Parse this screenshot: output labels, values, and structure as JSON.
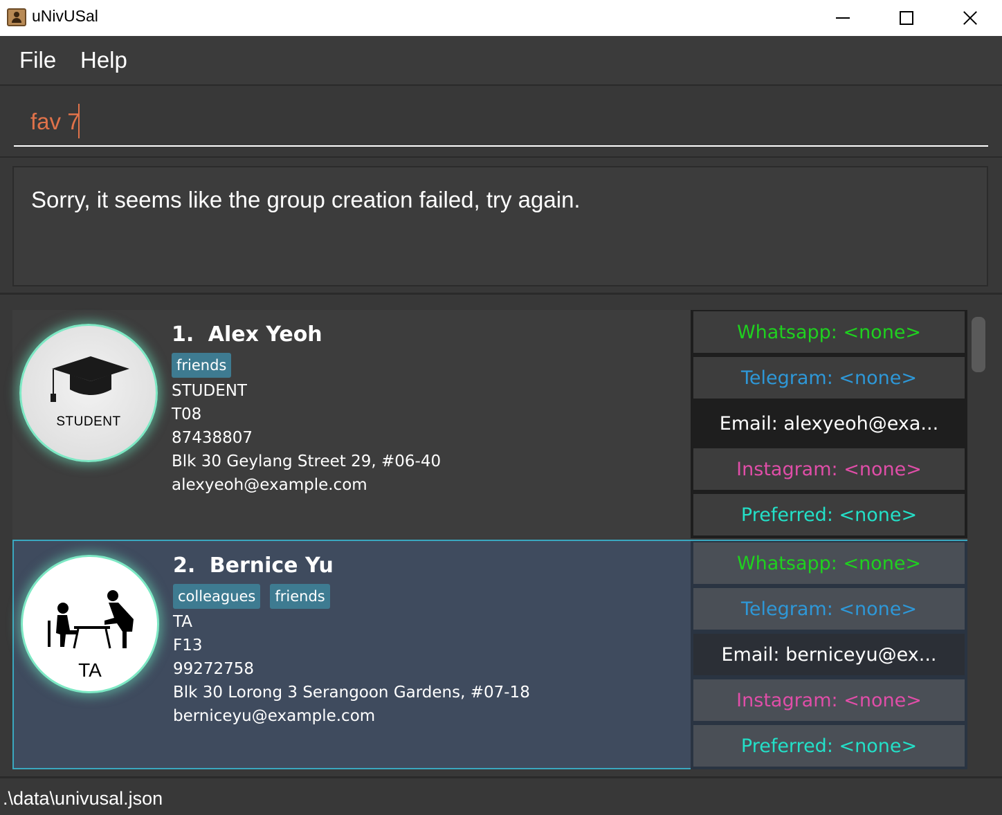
{
  "window": {
    "title": "uNivUSal",
    "app_icon": "contact-book-icon",
    "controls": [
      "minimize-icon",
      "maximize-icon",
      "close-icon"
    ]
  },
  "menu": {
    "file": "File",
    "help": "Help"
  },
  "command": {
    "value": "fav 7"
  },
  "result": {
    "message": "Sorry, it seems like the group creation failed, try again."
  },
  "persons": [
    {
      "index": "1.",
      "name": "Alex Yeoh",
      "avatar_label": "STUDENT",
      "avatar_icon": "graduation-cap-icon",
      "tags": [
        "friends"
      ],
      "role": "STUDENT",
      "tutorial": "T08",
      "phone": "87438807",
      "address": "Blk 30 Geylang Street 29, #06-40",
      "email": "alexyeoh@example.com",
      "contacts": {
        "whatsapp": "Whatsapp: <none>",
        "telegram": "Telegram: <none>",
        "email": "Email: alexyeoh@exa...",
        "instagram": "Instagram: <none>",
        "preferred": "Preferred: <none>"
      }
    },
    {
      "index": "2.",
      "name": "Bernice Yu",
      "avatar_label": "TA",
      "avatar_icon": "teaching-assistant-icon",
      "tags": [
        "colleagues",
        "friends"
      ],
      "role": "TA",
      "tutorial": "F13",
      "phone": "99272758",
      "address": "Blk 30 Lorong 3 Serangoon Gardens, #07-18",
      "email": "berniceyu@example.com",
      "contacts": {
        "whatsapp": "Whatsapp: <none>",
        "telegram": "Telegram: <none>",
        "email": "Email: berniceyu@ex...",
        "instagram": "Instagram: <none>",
        "preferred": "Preferred: <none>"
      }
    }
  ],
  "status": {
    "file_path": ".\\data\\univusal.json"
  },
  "colors": {
    "whatsapp": "#1fd11f",
    "telegram": "#2e98d8",
    "instagram": "#e04ea8",
    "preferred": "#23e0c8",
    "command_text": "#e0724a",
    "selected_card": "#3f4b5e",
    "tag": "#3e7b91"
  }
}
